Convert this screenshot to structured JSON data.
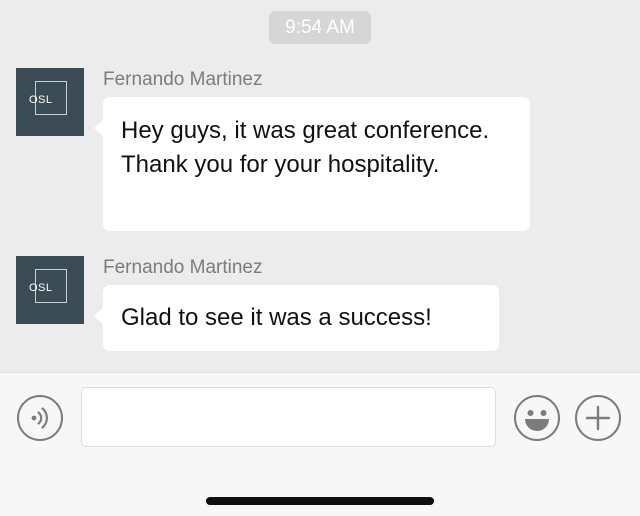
{
  "timestamp": "9:54 AM",
  "messages": [
    {
      "sender": "Fernando Martinez",
      "avatar_initials": "OSL",
      "text": "Hey guys, it was great conference. Thank you for your hospitality."
    },
    {
      "sender": "Fernando Martinez",
      "avatar_initials": "OSL",
      "text": "Glad to see it was a success!"
    }
  ],
  "input": {
    "value": "",
    "placeholder": ""
  },
  "icons": {
    "voice": "voice-icon",
    "emoji": "emoji-icon",
    "plus": "plus-icon"
  },
  "colors": {
    "chat_background": "#ececec",
    "bubble": "#ffffff",
    "avatar": "#3a4b55",
    "timestamp_pill": "#d6d6d6",
    "icon_gray": "#7c7c7c"
  }
}
